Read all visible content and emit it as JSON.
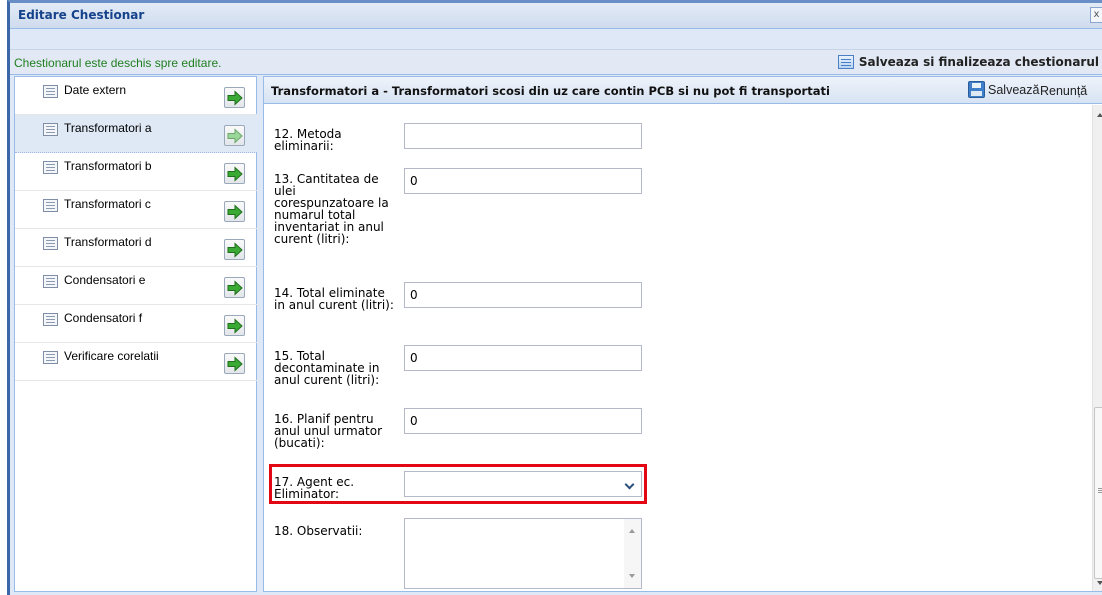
{
  "window": {
    "title": "Editare Chestionar",
    "close_label": "x"
  },
  "status": {
    "message": "Chestionarul este deschis spre editare.",
    "finalize_label": "Salveaza si finalizeaza chestionarul"
  },
  "sidebar": {
    "items": [
      {
        "label": "Date extern",
        "selected": false
      },
      {
        "label": "Transformatori a",
        "selected": true
      },
      {
        "label": "Transformatori b",
        "selected": false
      },
      {
        "label": "Transformatori c",
        "selected": false
      },
      {
        "label": "Transformatori d",
        "selected": false
      },
      {
        "label": "Condensatori e",
        "selected": false
      },
      {
        "label": "Condensatori f",
        "selected": false
      },
      {
        "label": "Verificare corelatii",
        "selected": false
      }
    ]
  },
  "main": {
    "title": "Transformatori a - Transformatori scosi din uz care contin PCB si nu pot fi transportati",
    "save_label": "Salvează",
    "cancel_label": "Renunță",
    "fields": {
      "f12": {
        "label": "12. Metoda eliminarii:",
        "value": ""
      },
      "f13": {
        "label": "13. Cantitatea de ulei corespunzatoare la numarul total inventariat in anul curent (litri):",
        "value": "0"
      },
      "f14": {
        "label": "14. Total eliminate in anul curent (litri):",
        "value": "0"
      },
      "f15": {
        "label": "15. Total decontaminate in anul curent (litri):",
        "value": "0"
      },
      "f16": {
        "label": "16. Planif pentru anul unul urmator (bucati):",
        "value": "0"
      },
      "f17": {
        "label": "17. Agent ec. Eliminator:",
        "value": ""
      },
      "f18": {
        "label": "18. Observatii:",
        "value": ""
      }
    }
  },
  "colors": {
    "accent_border": "#99bbe8",
    "status_text": "#207e20",
    "highlight": "#e30613",
    "arrow_green": "#3aaa35"
  },
  "icons": {
    "nav_item": "document-icon",
    "nav_go": "green-arrow-right-icon",
    "save": "floppy-disk-icon",
    "finalize": "form-list-icon"
  }
}
